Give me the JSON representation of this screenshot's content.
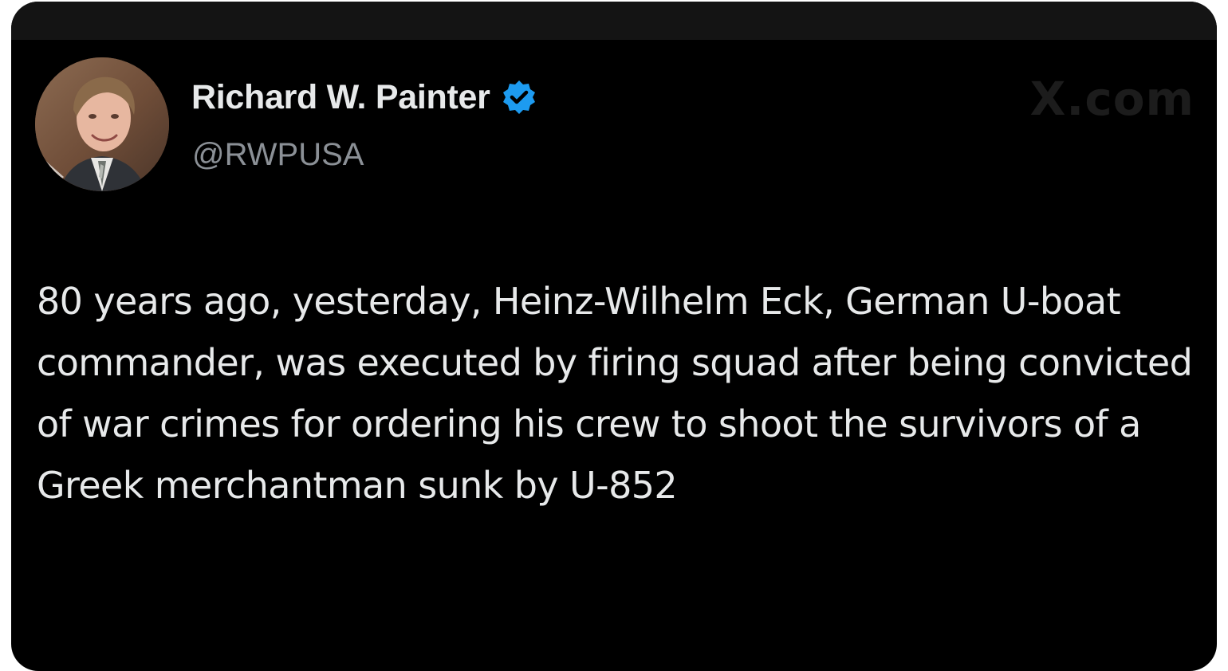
{
  "tweet": {
    "author": {
      "display_name": "Richard W. Painter",
      "handle": "@RWPUSA",
      "verified": true,
      "verified_badge_color": "#1d9bf0",
      "avatar_icon": "profile-photo"
    },
    "watermark": "X.com",
    "text": "80 years ago, yesterday, Heinz-Wilhelm Eck, German U-boat commander, was executed by firing squad after being convicted of war crimes for ordering his crew to shoot the survivors of a Greek merchantman sunk by U-852"
  },
  "colors": {
    "background": "#000000",
    "primary_text": "#e7e9ea",
    "secondary_text": "#8b9096",
    "accent": "#1d9bf0"
  }
}
